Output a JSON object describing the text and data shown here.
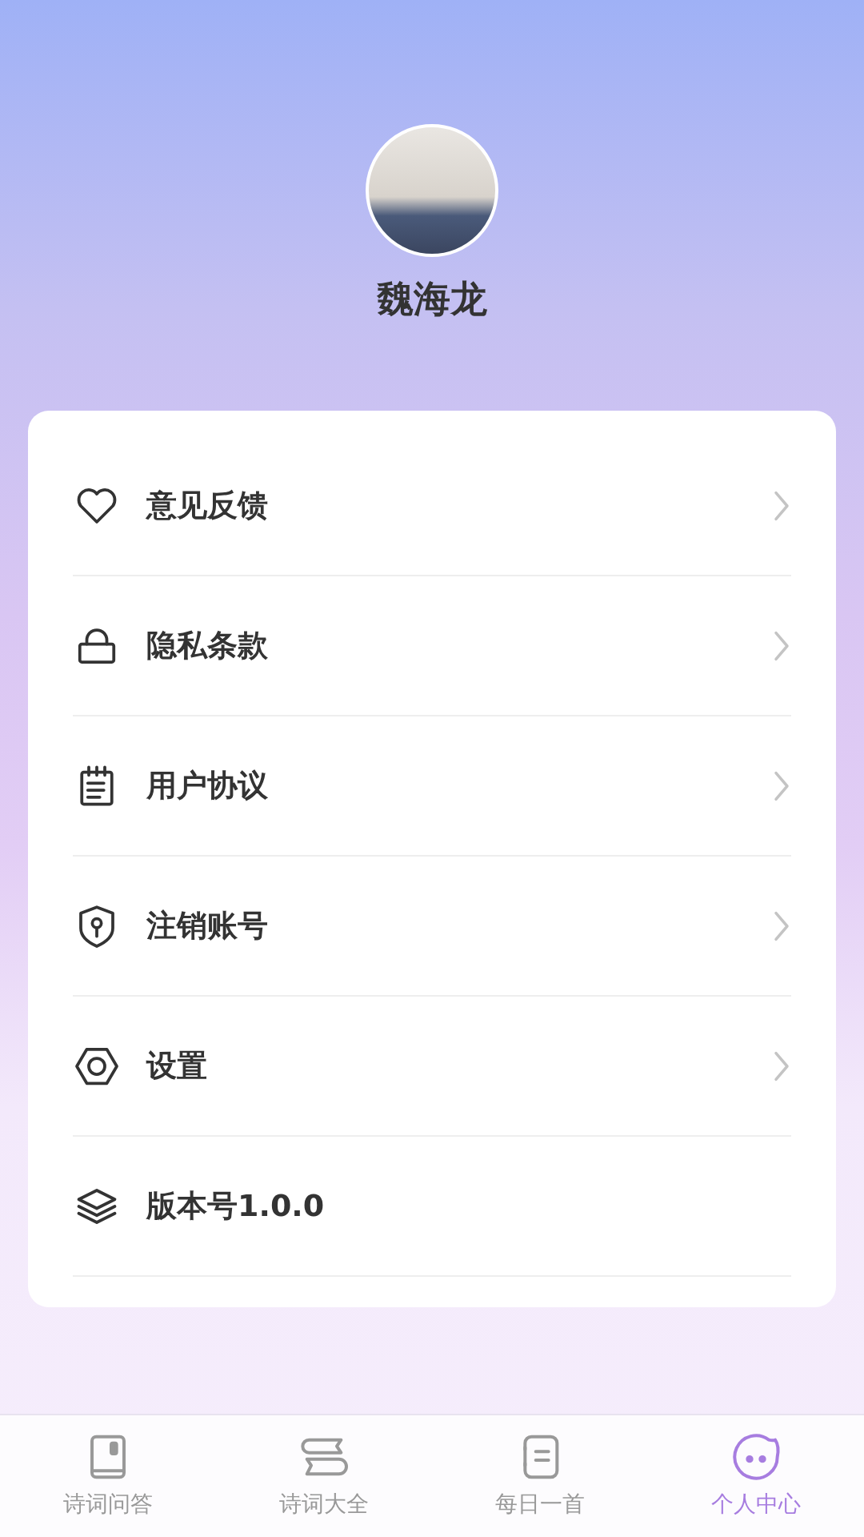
{
  "profile": {
    "name": "魏海龙"
  },
  "menu": [
    {
      "kind": "heart",
      "label": "意见反馈",
      "arrow": true
    },
    {
      "kind": "lock",
      "label": "隐私条款",
      "arrow": true
    },
    {
      "kind": "notepad",
      "label": "用户协议",
      "arrow": true
    },
    {
      "kind": "shield",
      "label": "注销账号",
      "arrow": true
    },
    {
      "kind": "hexagon",
      "label": "设置",
      "arrow": true
    },
    {
      "kind": "layers",
      "label": "版本号1.0.0",
      "arrow": false
    }
  ],
  "tabs": [
    {
      "kind": "book",
      "label": "诗词问答",
      "selected": false
    },
    {
      "kind": "scroll",
      "label": "诗词大全",
      "selected": false
    },
    {
      "kind": "notebook",
      "label": "每日一首",
      "selected": false
    },
    {
      "kind": "face",
      "label": "个人中心",
      "selected": true
    }
  ]
}
